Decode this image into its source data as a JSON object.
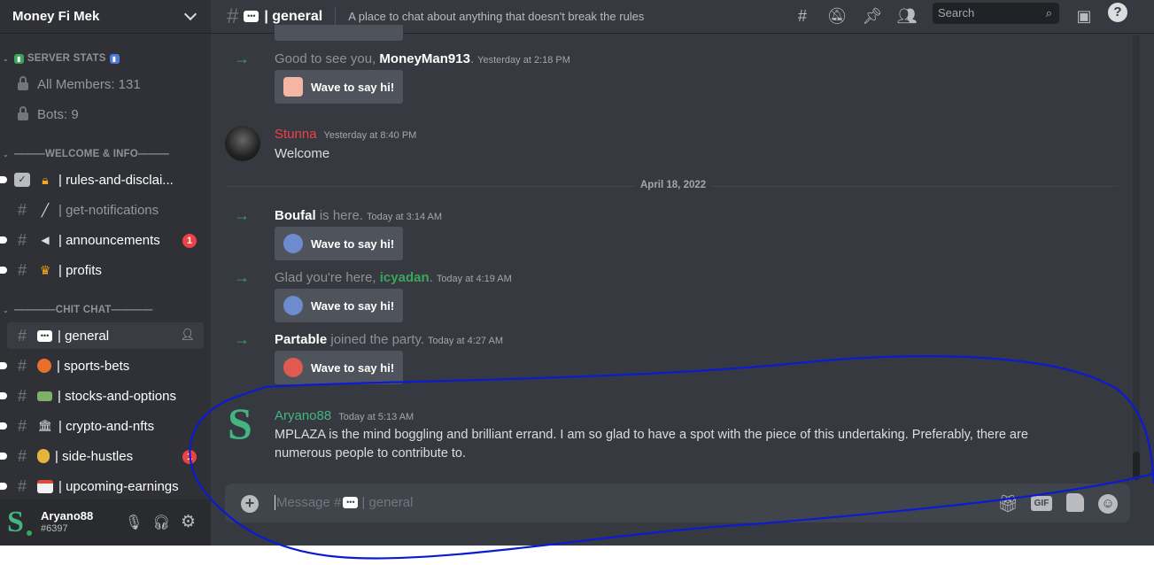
{
  "server": {
    "name": "Money Fi Mek"
  },
  "sidebar": {
    "server_stats": {
      "label": "SERVER STATS"
    },
    "all_members": "All Members: 131",
    "bots": "Bots: 9",
    "welcome_cat": "———WELCOME & INFO———",
    "chit_cat": "————CHIT CHAT————",
    "channels": [
      {
        "name": "| rules-and-disclai...",
        "emoji": "lock"
      },
      {
        "name": "| get-notifications",
        "emoji": "bell"
      },
      {
        "name": "| announcements",
        "emoji": "megaphone",
        "badge": "1"
      },
      {
        "name": "| profits",
        "emoji": "trophy"
      },
      {
        "name": "| general",
        "emoji": "speech"
      },
      {
        "name": "| sports-bets",
        "emoji": "basketball"
      },
      {
        "name": "| stocks-and-options",
        "emoji": "money"
      },
      {
        "name": "| crypto-and-nfts",
        "emoji": "bank"
      },
      {
        "name": "| side-hustles",
        "emoji": "moneybag",
        "badge": "1"
      },
      {
        "name": "| upcoming-earnings",
        "emoji": "calendar"
      }
    ]
  },
  "user": {
    "name": "Aryano88",
    "tag": "#6397"
  },
  "topbar": {
    "channel": "| general",
    "topic": "A place to chat about anything that doesn't break the rules",
    "search_placeholder": "Search"
  },
  "messages": {
    "sys1": {
      "text_before": "Good to see you, ",
      "name": "MoneyMan913",
      "text_after": ".",
      "time": "Yesterday at 2:18 PM"
    },
    "stunna": {
      "author": "Stunna",
      "time": "Yesterday at 8:40 PM",
      "text": "Welcome"
    },
    "date_divider": "April 18, 2022",
    "sys2": {
      "name": "Boufal",
      "text_after": " is here.",
      "time": "Today at 3:14 AM"
    },
    "sys3": {
      "text_before": "Glad you're here, ",
      "name": "icyadan",
      "text_after": ".",
      "time": "Today at 4:19 AM"
    },
    "sys4": {
      "name": "Partable",
      "text_after": " joined the party.",
      "time": "Today at 4:27 AM"
    },
    "wave_label": "Wave to say hi!",
    "aryano": {
      "author": "Aryano88",
      "time": "Today at 5:13 AM",
      "text": "MPLAZA is the mind boggling and brilliant errand. I am so glad to have a spot with the piece of this undertaking. Preferably, there are numerous people to contribute to."
    }
  },
  "composer": {
    "placeholder_prefix": "Message #",
    "placeholder_suffix": " | general",
    "gif": "GIF"
  },
  "colors": {
    "stunna": "#ed4245",
    "aryano": "#43b581",
    "icyadan": "#3ba55d",
    "accent": "#5865f2"
  }
}
